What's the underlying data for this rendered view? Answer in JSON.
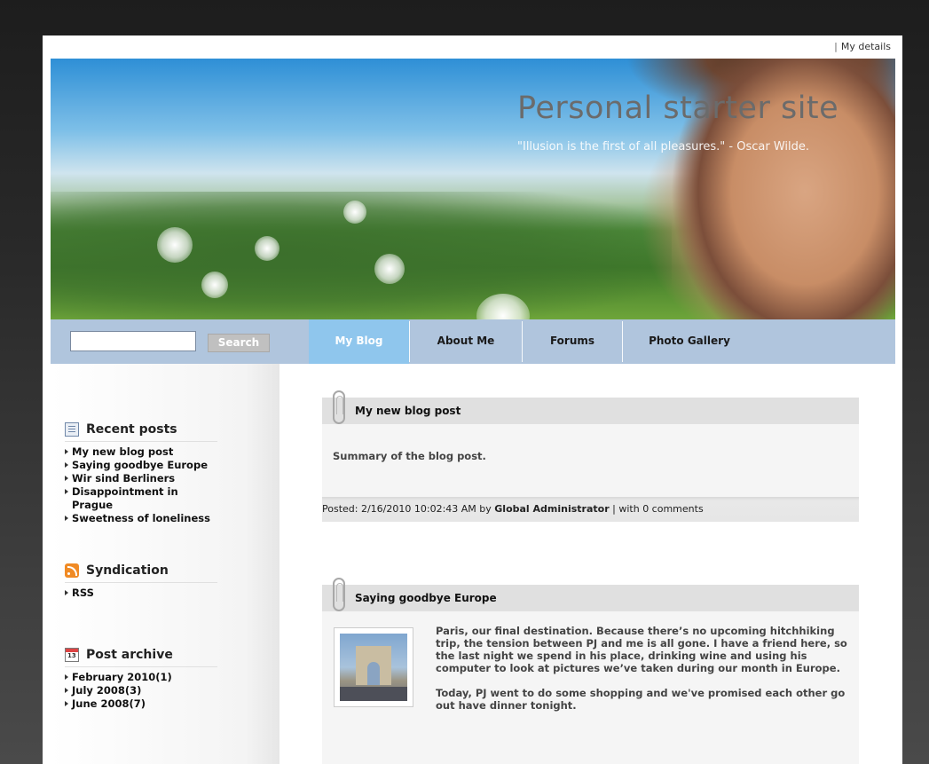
{
  "topbar": {
    "separator": "|",
    "my_details": "My details"
  },
  "header": {
    "title": "Personal starter site",
    "quote": "\"Illusion is the first of all pleasures.\" - Oscar Wilde."
  },
  "nav": {
    "search_placeholder": "",
    "search_value": "",
    "search_button": "Search",
    "tabs": [
      {
        "label": "My Blog",
        "active": true
      },
      {
        "label": "About Me",
        "active": false
      },
      {
        "label": "Forums",
        "active": false
      },
      {
        "label": "Photo Gallery",
        "active": false
      }
    ]
  },
  "sidebar": {
    "recent": {
      "icon": "document-icon",
      "title": "Recent posts",
      "items": [
        "My new blog post",
        "Saying goodbye Europe",
        "Wir sind Berliners",
        "Disappointment in Prague",
        "Sweetness of loneliness"
      ]
    },
    "syndication": {
      "icon": "rss-icon",
      "title": "Syndication",
      "items": [
        "RSS"
      ]
    },
    "archive": {
      "icon": "calendar-icon",
      "title": "Post archive",
      "items": [
        "February 2010(1)",
        "July 2008(3)",
        "June 2008(7)"
      ]
    }
  },
  "posts": [
    {
      "title": "My new blog post",
      "summary": "Summary of the blog post.",
      "footer_prefix": "Posted: 2/16/2010 10:02:43 AM by ",
      "author": "Global Administrator",
      "footer_suffix": " | with 0 comments"
    },
    {
      "title": "Saying goodbye Europe",
      "paragraph1": "Paris, our final destination. Because there’s no upcoming hitchhiking trip, the tension between PJ and me is all gone. I have a friend here, so the last night we spend in his place, drinking wine and using his computer to look at pictures we’ve taken during our month in Europe.",
      "paragraph2": "Today, PJ went to do some shopping and we've promised each other go out have dinner tonight."
    }
  ],
  "colors": {
    "navbar": "#b0c5dd",
    "active_tab": "#8fc6ed",
    "post_header": "#e0e0e0"
  }
}
